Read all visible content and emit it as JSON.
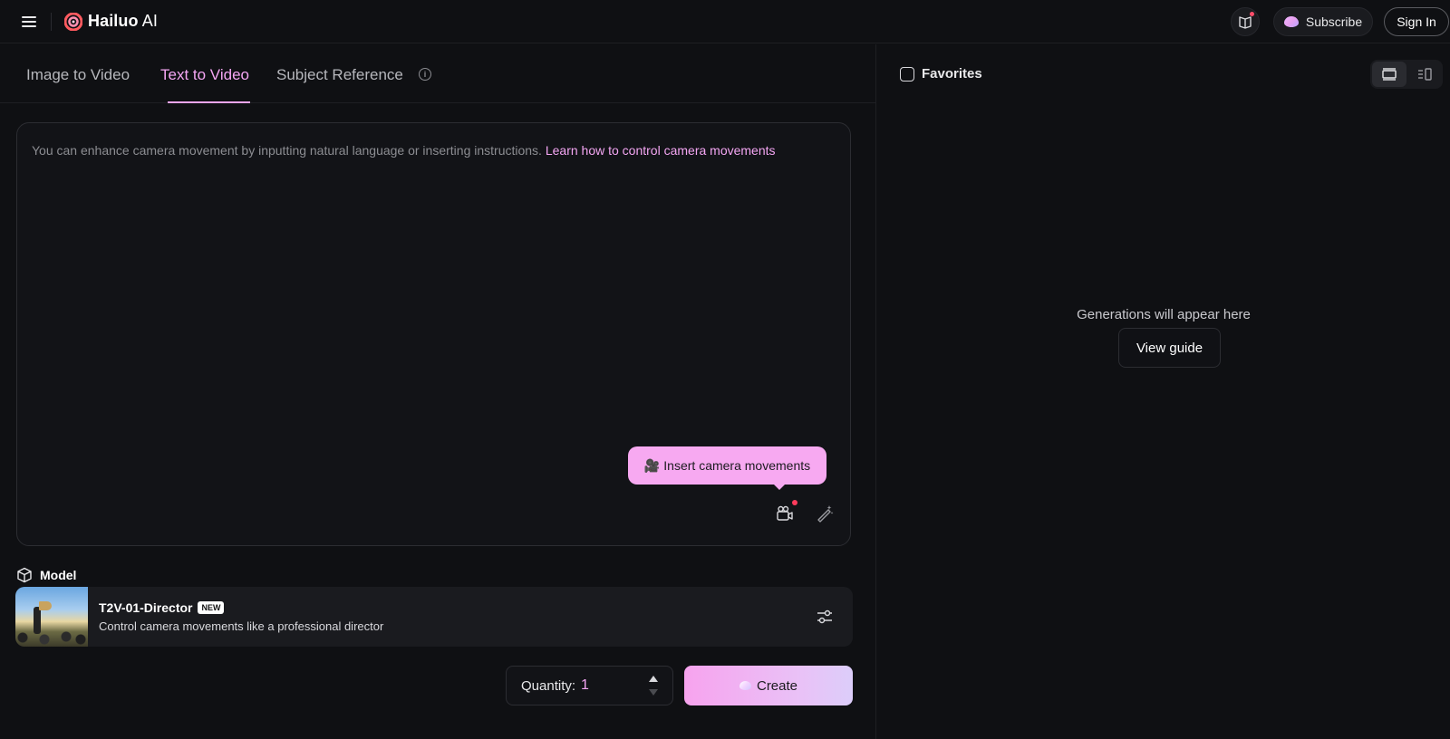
{
  "app": {
    "name_main": "Hailuo",
    "name_suffix": " AI"
  },
  "header": {
    "subscribe_label": "Subscribe",
    "signin_label": "Sign In"
  },
  "tabs": [
    {
      "label": "Image to Video"
    },
    {
      "label": "Text to Video",
      "active": true
    },
    {
      "label": "Subject Reference"
    }
  ],
  "prompt": {
    "hint": "You can enhance camera movement by inputting natural language or inserting instructions. ",
    "link": "Learn how to control camera movements",
    "tooltip": "Insert camera movements"
  },
  "model": {
    "section_label": "Model",
    "name": "T2V-01-Director",
    "badge": "NEW",
    "description": "Control camera movements like a professional director"
  },
  "quantity": {
    "label": "Quantity:",
    "value": "1"
  },
  "create_label": "Create",
  "right": {
    "favorites_label": "Favorites",
    "empty_text": "Generations will appear here",
    "guide_label": "View guide"
  },
  "colors": {
    "accent": "#f4a6f3",
    "background": "#0f1013"
  },
  "icons": [
    "menu-icon",
    "hailuo-logo-icon",
    "book-icon",
    "gem-icon",
    "info-icon",
    "camera-icon",
    "magic-wand-icon",
    "cube-icon",
    "sliders-icon",
    "list-view-icon",
    "split-view-icon"
  ]
}
